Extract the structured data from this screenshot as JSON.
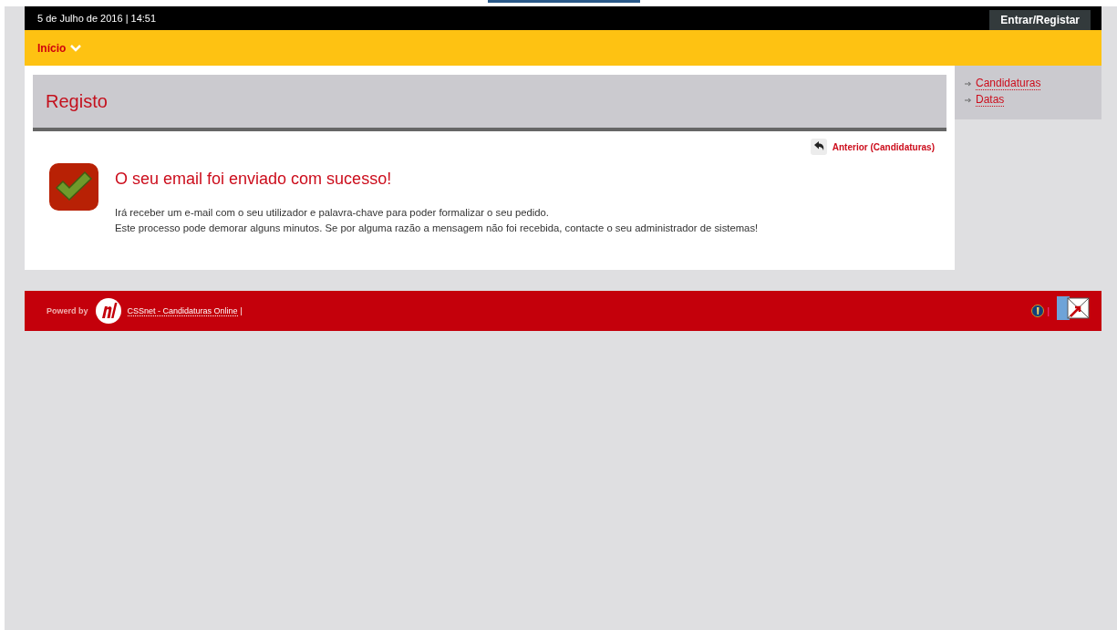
{
  "top_bar": {
    "datetime": "5 de Julho de 2016 | 14:51",
    "login_button": "Entrar/Registar"
  },
  "nav": {
    "items": [
      {
        "label": "Início",
        "has_dropdown": true
      }
    ]
  },
  "sidebar": {
    "links": [
      {
        "label": "Candidaturas"
      },
      {
        "label": "Datas"
      }
    ]
  },
  "page": {
    "title": "Registo",
    "back_link": "Anterior (Candidaturas)",
    "message": {
      "heading": "O seu email foi enviado com sucesso!",
      "lines": [
        "Irá receber um e-mail com o seu utilizador e palavra-chave para poder formalizar o seu pedido.",
        "Este processo pode demorar alguns minutos. Se por alguma razão a mensagem não foi recebida, contacte o seu administrador de sistemas!"
      ]
    }
  },
  "footer": {
    "powered_by": "Powerd by",
    "link": "CSSnet - Candidaturas Online",
    "separator": "|",
    "icon_separator": "|"
  }
}
